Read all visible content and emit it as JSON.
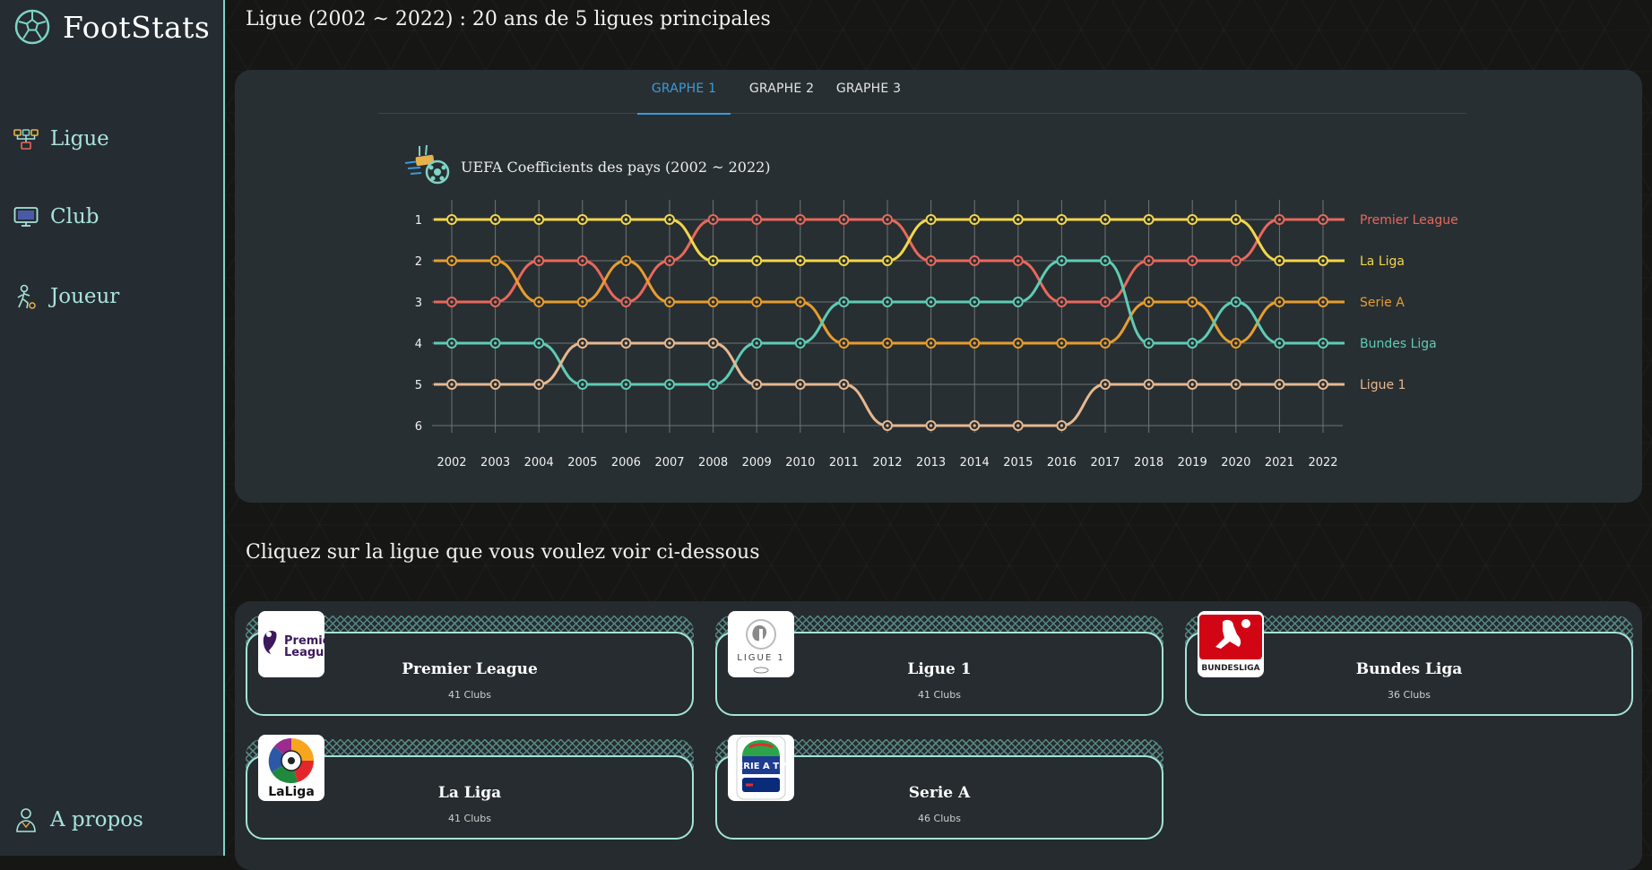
{
  "app": {
    "name": "FootStats"
  },
  "nav": [
    {
      "label": "Ligue",
      "icon": "league-icon"
    },
    {
      "label": "Club",
      "icon": "club-icon"
    },
    {
      "label": "Joueur",
      "icon": "player-icon"
    },
    {
      "label": "A propos",
      "icon": "about-icon"
    }
  ],
  "page": {
    "title": "Ligue (2002 ~ 2022) : 20 ans de 5 ligues principales",
    "section_title": "Cliquez sur la ligue que vous voulez voir ci-dessous"
  },
  "tabs": [
    {
      "label": "GRAPHE 1",
      "active": true
    },
    {
      "label": "GRAPHE 2",
      "active": false
    },
    {
      "label": "GRAPHE 3",
      "active": false
    }
  ],
  "chart_data": {
    "type": "line",
    "subtype": "bump",
    "title": "UEFA Coefficients des pays (2002 ~ 2022)",
    "x": [
      "2002",
      "2003",
      "2004",
      "2005",
      "2006",
      "2007",
      "2008",
      "2009",
      "2010",
      "2011",
      "2012",
      "2013",
      "2014",
      "2015",
      "2016",
      "2017",
      "2018",
      "2019",
      "2020",
      "2021",
      "2022"
    ],
    "y_ticks": [
      1,
      2,
      3,
      4,
      5,
      6
    ],
    "ylim": [
      1,
      6
    ],
    "y_inverted": true,
    "grid": true,
    "legend": "right, labels at line ends",
    "series": [
      {
        "name": "Premier League",
        "color": "#e8685c",
        "values": [
          3,
          3,
          2,
          2,
          3,
          2,
          1,
          1,
          1,
          1,
          1,
          2,
          2,
          2,
          3,
          3,
          2,
          2,
          2,
          1,
          1
        ]
      },
      {
        "name": "La Liga",
        "color": "#f2d64b",
        "values": [
          1,
          1,
          1,
          1,
          1,
          1,
          2,
          2,
          2,
          2,
          2,
          1,
          1,
          1,
          1,
          1,
          1,
          1,
          1,
          2,
          2
        ]
      },
      {
        "name": "Serie A",
        "color": "#e79d2f",
        "values": [
          2,
          2,
          3,
          3,
          2,
          3,
          3,
          3,
          3,
          4,
          4,
          4,
          4,
          4,
          4,
          4,
          3,
          3,
          4,
          3,
          3
        ]
      },
      {
        "name": "Bundes Liga",
        "color": "#5fcbb5",
        "values": [
          4,
          4,
          4,
          5,
          5,
          5,
          5,
          4,
          4,
          3,
          3,
          3,
          3,
          3,
          2,
          2,
          4,
          4,
          3,
          4,
          4
        ]
      },
      {
        "name": "Ligue 1",
        "color": "#e6b890",
        "values": [
          5,
          5,
          5,
          4,
          4,
          4,
          4,
          5,
          5,
          5,
          6,
          6,
          6,
          6,
          6,
          5,
          5,
          5,
          5,
          5,
          5
        ]
      }
    ]
  },
  "leagues": [
    {
      "name": "Premier League",
      "count": "41 Clubs",
      "logo_text": "Premier League",
      "icon": "premier-league-logo"
    },
    {
      "name": "Ligue 1",
      "count": "41 Clubs",
      "logo_text": "LIGUE 1",
      "icon": "ligue-1-logo"
    },
    {
      "name": "Bundes Liga",
      "count": "36 Clubs",
      "logo_text": "BUNDESLIGA",
      "icon": "bundesliga-logo"
    },
    {
      "name": "La Liga",
      "count": "41 Clubs",
      "logo_text": "LaLiga",
      "icon": "laliga-logo"
    },
    {
      "name": "Serie A",
      "count": "46 Clubs",
      "logo_text": "SERIE A TIM",
      "icon": "serie-a-logo"
    }
  ]
}
